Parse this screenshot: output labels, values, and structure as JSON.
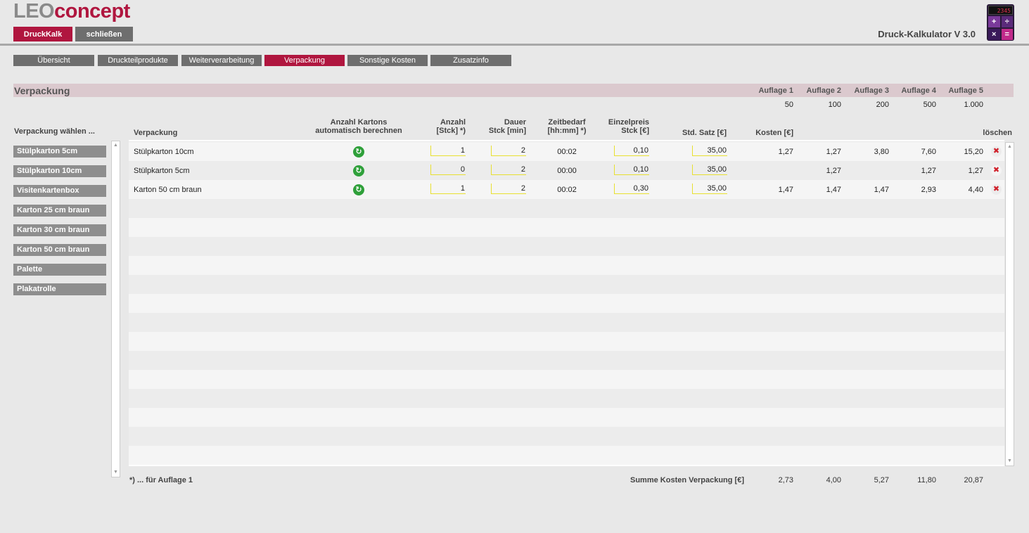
{
  "logo": {
    "part1": "LEO",
    "part2": "concept"
  },
  "top_buttons": {
    "druckkalk": "DruckKalk",
    "close": "schließen"
  },
  "app_title": "Druck-Kalkulator V 3.0",
  "calculator_display": "2345",
  "tabs": [
    "Übersicht",
    "Druckteilprodukte",
    "Weiterverarbeitung",
    "Verpackung",
    "Sonstige Kosten",
    "Zusatzinfo"
  ],
  "active_tab": "Verpackung",
  "section": {
    "title": "Verpackung",
    "auflagen": [
      {
        "label": "Auflage 1",
        "value": "50"
      },
      {
        "label": "Auflage 2",
        "value": "100"
      },
      {
        "label": "Auflage 3",
        "value": "200"
      },
      {
        "label": "Auflage 4",
        "value": "500"
      },
      {
        "label": "Auflage 5",
        "value": "1.000"
      }
    ]
  },
  "sidebar": {
    "title": "Verpackung wählen ...",
    "items": [
      "Stülpkarton 5cm",
      "Stülpkarton 10cm",
      "Visitenkartenbox",
      "Karton 25 cm braun",
      "Karton 30 cm braun",
      "Karton 50 cm braun",
      "Palette",
      "Plakatrolle"
    ]
  },
  "columns": {
    "verpackung": "Verpackung",
    "auto_l1": "Anzahl Kartons",
    "auto_l2": "automatisch berechnen",
    "anzahl_l1": "Anzahl",
    "anzahl_l2": "[Stck] *)",
    "dauer_l1": "Dauer",
    "dauer_l2": "Stck [min]",
    "zeit_l1": "Zeitbedarf",
    "zeit_l2": "[hh:mm] *)",
    "preis_l1": "Einzelpreis",
    "preis_l2": "Stck [€]",
    "satz": "Std. Satz [€]",
    "kosten": "Kosten [€]",
    "loeschen": "löschen"
  },
  "rows": [
    {
      "name": "Stülpkarton 10cm",
      "anzahl": "1",
      "dauer": "2",
      "zeit": "00:02",
      "preis": "0,10",
      "satz": "35,00",
      "kosten": [
        "1,27",
        "1,27",
        "3,80",
        "7,60",
        "15,20"
      ]
    },
    {
      "name": "Stülpkarton 5cm",
      "anzahl": "0",
      "dauer": "2",
      "zeit": "00:00",
      "preis": "0,10",
      "satz": "35,00",
      "kosten": [
        "",
        "1,27",
        "",
        "1,27",
        "1,27"
      ]
    },
    {
      "name": "Karton 50 cm braun",
      "anzahl": "1",
      "dauer": "2",
      "zeit": "00:02",
      "preis": "0,30",
      "satz": "35,00",
      "kosten": [
        "1,47",
        "1,47",
        "1,47",
        "2,93",
        "4,40"
      ]
    }
  ],
  "footer": {
    "note": "*) ... für Auflage 1",
    "sum_label": "Summe Kosten Verpackung [€]",
    "sums": [
      "2,73",
      "4,00",
      "5,27",
      "11,80",
      "20,87"
    ]
  }
}
